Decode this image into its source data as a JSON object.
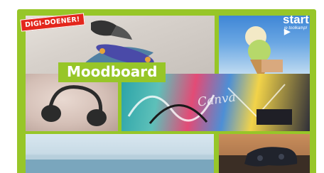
{
  "badge": {
    "label": "DIGI-DOENER!"
  },
  "start": {
    "label": "start",
    "sub_label": "je toolkamp!"
  },
  "title": {
    "label": "Moodboard"
  },
  "graffiti": {
    "text": "Canva"
  },
  "colors": {
    "accent_green": "#97c628",
    "badge_red": "#e3261c"
  },
  "icons": {
    "start_arrow": "play-triangle-icon"
  }
}
